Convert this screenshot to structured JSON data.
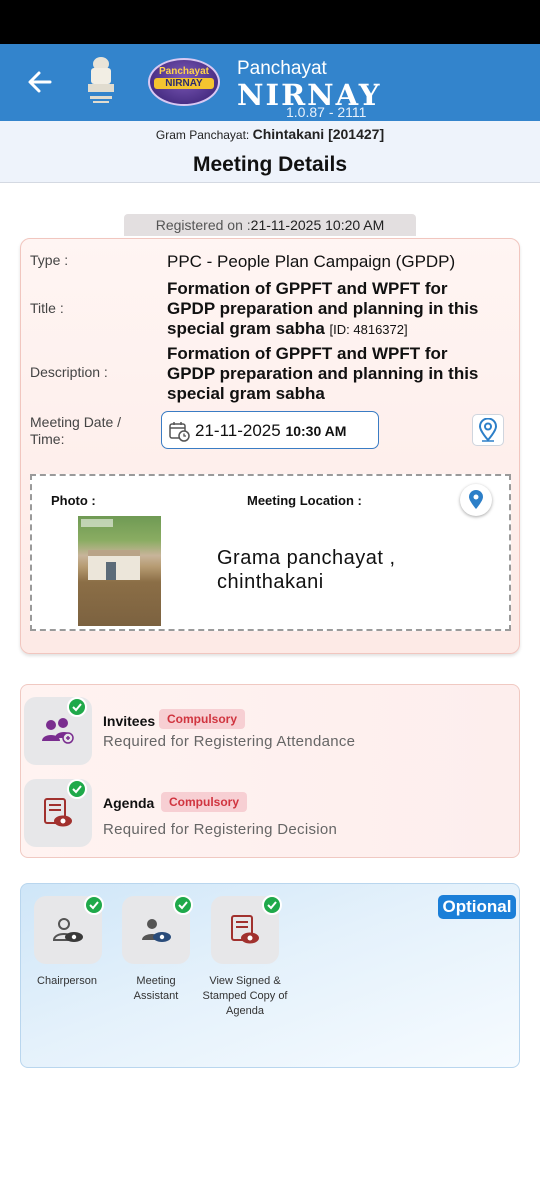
{
  "header": {
    "title_small": "Panchayat",
    "title_big": "NIRNAY",
    "version": "1.0.87 - 2111",
    "logo_top": "Panchayat",
    "logo_mid": "NIRNAY",
    "back_icon": "arrow-left-icon",
    "emblem_icon": "national-emblem-icon"
  },
  "gram_panchayat": {
    "label": "Gram Panchayat:",
    "value": "Chintakani [201427]"
  },
  "page_title": "Meeting Details",
  "meeting": {
    "registered_label": "Registered on :",
    "registered_value": "21-11-2025 10:20 AM",
    "type_label": "Type :",
    "type_value": "PPC - People Plan Campaign (GPDP)",
    "title_label": "Title :",
    "title_value": "Formation of GPPFT and WPFT for GPDP preparation and planning in this special gram sabha",
    "title_id": "[ID: 4816372]",
    "description_label": "Description :",
    "description_value": "Formation of GPPFT and WPFT for GPDP preparation and planning in this special gram sabha",
    "datetime_label": "Meeting Date / Time:",
    "date_value": "21-11-2025",
    "time_value": "10:30 AM",
    "photo_label": "Photo :",
    "location_label": "Meeting Location :",
    "location_value": "Grama panchayat , chinthakani"
  },
  "requirements": [
    {
      "title": "Invitees",
      "badge": "Compulsory",
      "subtitle": "Required for Registering Attendance",
      "icon": "people-group-icon"
    },
    {
      "title": "Agenda",
      "badge": "Compulsory",
      "subtitle": "Required for Registering Decision",
      "icon": "document-view-icon"
    }
  ],
  "optional": {
    "badge": "Optional",
    "items": [
      {
        "label": "Chairperson",
        "icon": "person-view-icon"
      },
      {
        "label": "Meeting Assistant",
        "icon": "person-view-icon"
      },
      {
        "label": "View Signed & Stamped Copy of Agenda",
        "icon": "document-view-icon"
      }
    ]
  },
  "colors": {
    "header_bg": "#3384cc",
    "compulsory_badge_bg": "#f7cfd3",
    "compulsory_badge_text": "#d0343f",
    "optional_badge": "#1b7fd8",
    "check_green": "#1fa94a"
  }
}
